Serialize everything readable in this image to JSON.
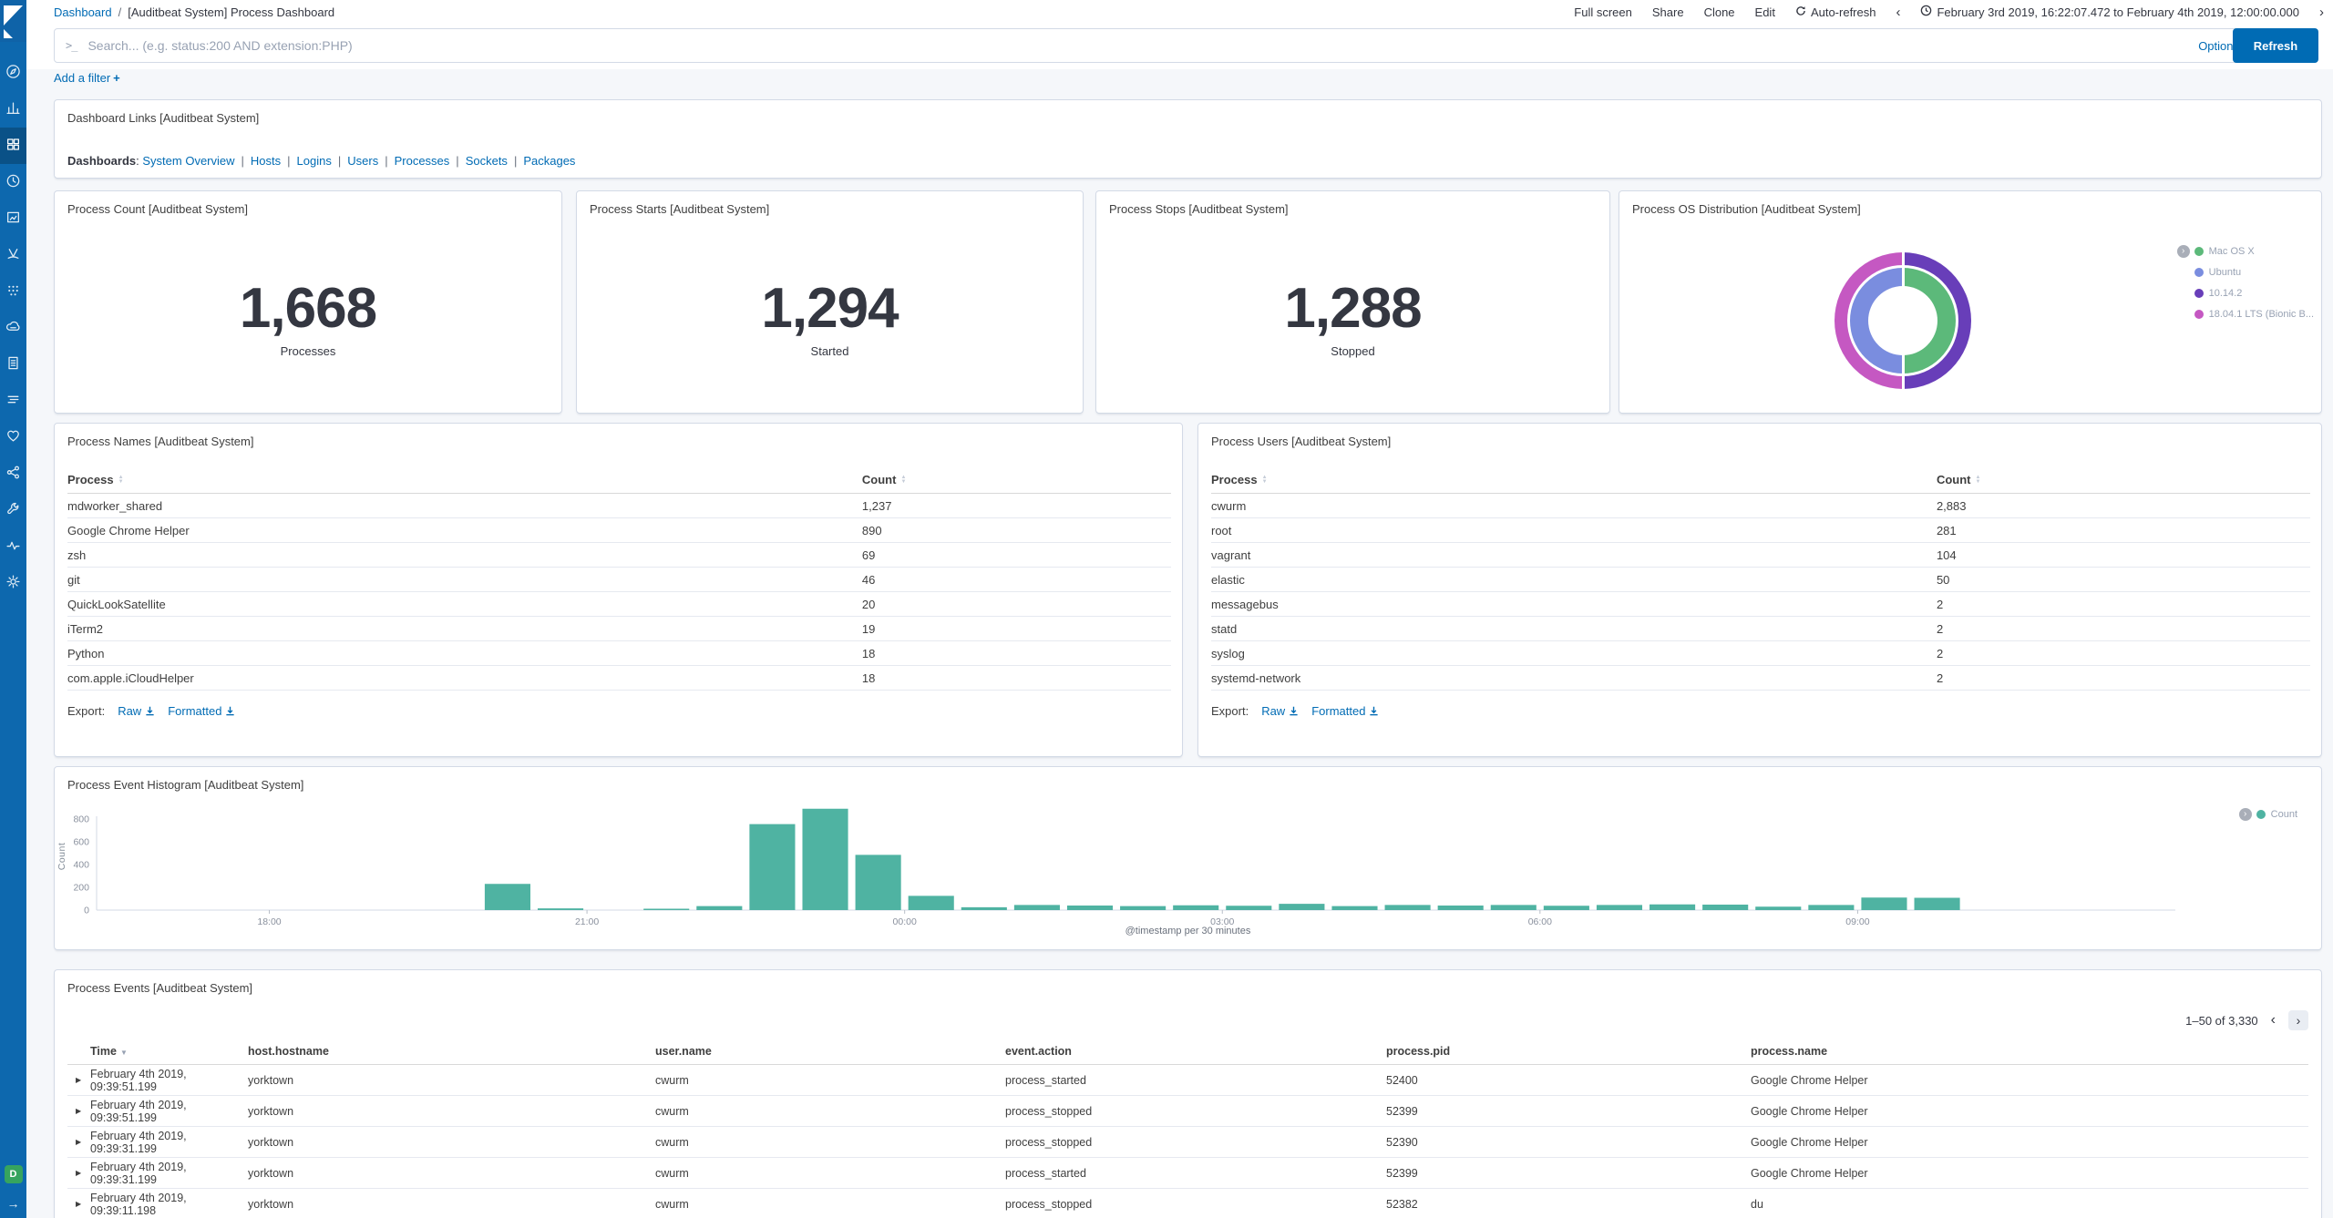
{
  "chrome": {
    "breadcrumb": {
      "root": "Dashboard",
      "separator": "/",
      "current": "[Auditbeat System] Process Dashboard"
    },
    "menu": [
      "Full screen",
      "Share",
      "Clone",
      "Edit"
    ],
    "auto_refresh_label": "Auto-refresh",
    "time_back_icon": "‹",
    "time_forward_icon": "›",
    "time_range": "February 3rd 2019, 16:22:07.472 to February 4th 2019, 12:00:00.000"
  },
  "query_bar": {
    "prompt_icon": ">_",
    "placeholder": "Search... (e.g. status:200 AND extension:PHP)",
    "options_label": "Options",
    "refresh_label": "Refresh"
  },
  "filter_bar": {
    "add_filter_label": "Add a filter",
    "plus_icon": "+"
  },
  "sidebar": {
    "space_badge": "D",
    "items": [
      {
        "id": "discover",
        "icon": "compass",
        "active": false
      },
      {
        "id": "visualize",
        "icon": "bars",
        "active": false
      },
      {
        "id": "dashboard",
        "icon": "grid",
        "active": true
      },
      {
        "id": "timelion",
        "icon": "clock",
        "active": false
      },
      {
        "id": "canvas",
        "icon": "frame",
        "active": false
      },
      {
        "id": "maps",
        "icon": "vmap",
        "active": false
      },
      {
        "id": "machine-learning",
        "icon": "ml",
        "active": false
      },
      {
        "id": "infrastructure",
        "icon": "cloud",
        "active": false
      },
      {
        "id": "logs",
        "icon": "doc",
        "active": false
      },
      {
        "id": "apm",
        "icon": "lines",
        "active": false
      },
      {
        "id": "uptime",
        "icon": "heart",
        "active": false
      },
      {
        "id": "graph",
        "icon": "share",
        "active": false
      },
      {
        "id": "dev-tools",
        "icon": "wrench",
        "active": false
      },
      {
        "id": "monitoring",
        "icon": "pulse",
        "active": false
      },
      {
        "id": "management",
        "icon": "gear",
        "active": false
      }
    ]
  },
  "panels": {
    "links": {
      "title": "Dashboard Links [Auditbeat System]",
      "label": "Dashboards",
      "colon": ":",
      "separator": "|",
      "links": [
        "System Overview",
        "Hosts",
        "Logins",
        "Users",
        "Processes",
        "Sockets",
        "Packages"
      ]
    },
    "metrics": [
      {
        "title": "Process Count [Auditbeat System]",
        "value": "1,668",
        "label": "Processes"
      },
      {
        "title": "Process Starts [Auditbeat System]",
        "value": "1,294",
        "label": "Started"
      },
      {
        "title": "Process Stops [Auditbeat System]",
        "value": "1,288",
        "label": "Stopped"
      }
    ],
    "os_distribution": {
      "title": "Process OS Distribution [Auditbeat System]"
    },
    "process_names": {
      "title": "Process Names [Auditbeat System]",
      "columns": [
        "Process",
        "Count"
      ],
      "rows": [
        [
          "mdworker_shared",
          "1,237"
        ],
        [
          "Google Chrome Helper",
          "890"
        ],
        [
          "zsh",
          "69"
        ],
        [
          "git",
          "46"
        ],
        [
          "QuickLookSatellite",
          "20"
        ],
        [
          "iTerm2",
          "19"
        ],
        [
          "Python",
          "18"
        ],
        [
          "com.apple.iCloudHelper",
          "18"
        ]
      ],
      "export_label": "Export:",
      "raw_label": "Raw",
      "formatted_label": "Formatted"
    },
    "process_users": {
      "title": "Process Users [Auditbeat System]",
      "columns": [
        "Process",
        "Count"
      ],
      "rows": [
        [
          "cwurm",
          "2,883"
        ],
        [
          "root",
          "281"
        ],
        [
          "vagrant",
          "104"
        ],
        [
          "elastic",
          "50"
        ],
        [
          "messagebus",
          "2"
        ],
        [
          "statd",
          "2"
        ],
        [
          "syslog",
          "2"
        ],
        [
          "systemd-network",
          "2"
        ]
      ],
      "export_label": "Export:",
      "raw_label": "Raw",
      "formatted_label": "Formatted"
    },
    "events": {
      "title": "Process Events [Auditbeat System]",
      "pagination": "1–50 of 3,330",
      "prev_icon": "‹",
      "next_icon": "›",
      "columns": [
        "Time",
        "host.hostname",
        "user.name",
        "event.action",
        "process.pid",
        "process.name"
      ],
      "rows": [
        [
          "February 4th 2019, 09:39:51.199",
          "yorktown",
          "cwurm",
          "process_started",
          "52400",
          "Google Chrome Helper"
        ],
        [
          "February 4th 2019, 09:39:51.199",
          "yorktown",
          "cwurm",
          "process_stopped",
          "52399",
          "Google Chrome Helper"
        ],
        [
          "February 4th 2019, 09:39:31.199",
          "yorktown",
          "cwurm",
          "process_stopped",
          "52390",
          "Google Chrome Helper"
        ],
        [
          "February 4th 2019, 09:39:31.199",
          "yorktown",
          "cwurm",
          "process_started",
          "52399",
          "Google Chrome Helper"
        ],
        [
          "February 4th 2019, 09:39:11.198",
          "yorktown",
          "cwurm",
          "process_stopped",
          "52382",
          "du"
        ]
      ]
    }
  },
  "chart_data": [
    {
      "type": "bar",
      "title": "Process Event Histogram [Auditbeat System]",
      "ylabel": "Count",
      "xlabel": "@timestamp per 30 minutes",
      "legend": [
        "Count"
      ],
      "legend_position": "top-right",
      "grid": false,
      "bar_color": "#4FB3A2",
      "bucket_minutes": 30,
      "x_window": {
        "start": "16:22:07",
        "end": "12:00:00"
      },
      "x_ticks": [
        "18:00",
        "21:00",
        "00:00",
        "03:00",
        "06:00",
        "09:00"
      ],
      "y_ticks": [
        0,
        200,
        400,
        600,
        800
      ],
      "ylim": [
        0,
        900
      ],
      "bars": [
        {
          "t": "20:00",
          "v": 230
        },
        {
          "t": "20:30",
          "v": 15
        },
        {
          "t": "21:30",
          "v": 5
        },
        {
          "t": "22:00",
          "v": 35
        },
        {
          "t": "22:30",
          "v": 755
        },
        {
          "t": "23:00",
          "v": 890
        },
        {
          "t": "23:30",
          "v": 485
        },
        {
          "t": "00:00",
          "v": 125
        },
        {
          "t": "00:30",
          "v": 25
        },
        {
          "t": "01:00",
          "v": 45
        },
        {
          "t": "01:30",
          "v": 40
        },
        {
          "t": "02:00",
          "v": 35
        },
        {
          "t": "02:30",
          "v": 42
        },
        {
          "t": "03:00",
          "v": 38
        },
        {
          "t": "03:30",
          "v": 55
        },
        {
          "t": "04:00",
          "v": 35
        },
        {
          "t": "04:30",
          "v": 45
        },
        {
          "t": "05:00",
          "v": 40
        },
        {
          "t": "05:30",
          "v": 45
        },
        {
          "t": "06:00",
          "v": 38
        },
        {
          "t": "06:30",
          "v": 45
        },
        {
          "t": "07:00",
          "v": 50
        },
        {
          "t": "07:30",
          "v": 48
        },
        {
          "t": "08:00",
          "v": 30
        },
        {
          "t": "08:30",
          "v": 45
        },
        {
          "t": "09:00",
          "v": 110
        },
        {
          "t": "09:30",
          "v": 108
        }
      ]
    },
    {
      "type": "pie",
      "title": "Process OS Distribution [Auditbeat System]",
      "donut": true,
      "rings": [
        {
          "name": "inner",
          "slices": [
            {
              "label": "Mac OS X",
              "value_pct": 50,
              "color": "#5CB97A"
            },
            {
              "label": "Ubuntu",
              "value_pct": 50,
              "color": "#7A8DDF"
            }
          ]
        },
        {
          "name": "outer",
          "slices": [
            {
              "label": "10.14.2",
              "value_pct": 50,
              "color": "#683EB9"
            },
            {
              "label": "18.04.1 LTS (Bionic B...",
              "value_pct": 50,
              "color": "#C558C2"
            }
          ]
        }
      ],
      "legend": [
        {
          "label": "Mac OS X",
          "color": "#5CB97A"
        },
        {
          "label": "Ubuntu",
          "color": "#7A8DDF"
        },
        {
          "label": "10.14.2",
          "color": "#683EB9"
        },
        {
          "label": "18.04.1 LTS (Bionic B...",
          "color": "#C558C2"
        }
      ]
    }
  ]
}
